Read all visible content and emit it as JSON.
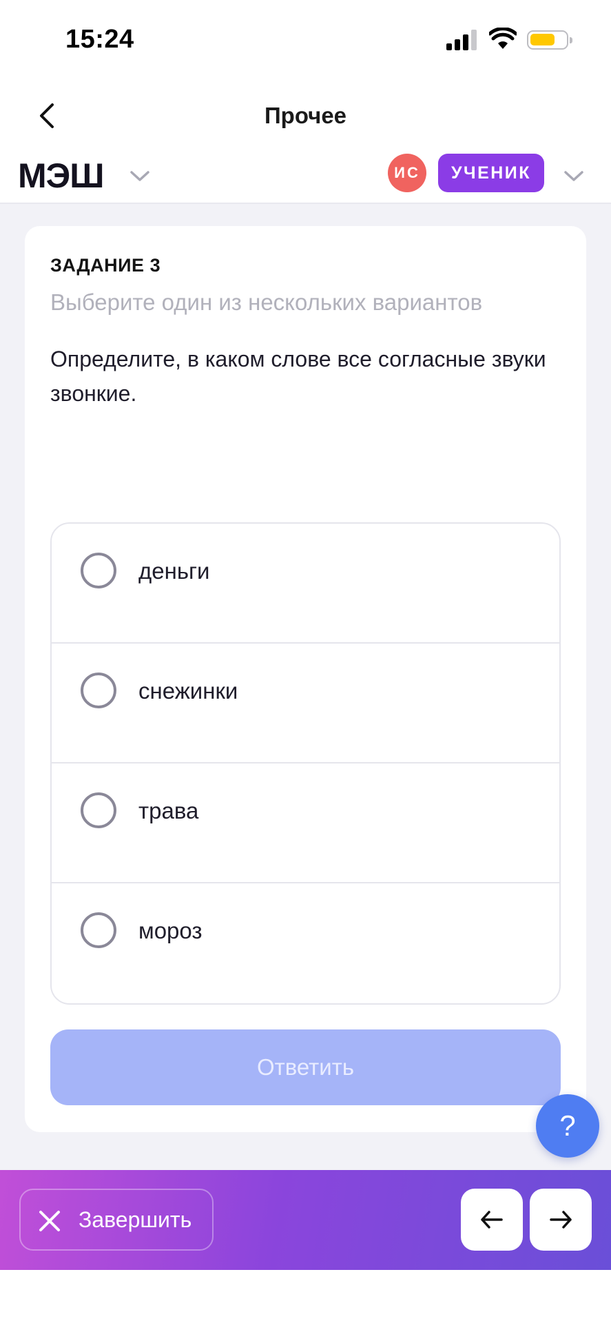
{
  "status_bar": {
    "time": "15:24",
    "battery_level": 0.7,
    "battery_color": "#ffc800"
  },
  "nav": {
    "back_icon": "chevron-left-icon",
    "title": "Прочее"
  },
  "app_header": {
    "logo_text": "МЭШ",
    "avatar_initials": "ИС",
    "avatar_color": "#f0635f",
    "role_label": "УЧЕНИК",
    "role_color": "#8b3ce6"
  },
  "task": {
    "number_label": "ЗАДАНИЕ 3",
    "type_label": "Выберите один из нескольких вариантов",
    "question": "Определите, в каком слове все согласные звуки звонкие.",
    "options": [
      {
        "label": "деньги",
        "selected": false
      },
      {
        "label": "снежинки",
        "selected": false
      },
      {
        "label": "трава",
        "selected": false
      },
      {
        "label": "мороз",
        "selected": false
      }
    ],
    "submit_label": "Ответить",
    "submit_enabled": false
  },
  "help": {
    "label": "?"
  },
  "bottom_bar": {
    "finish_label": "Завершить",
    "prev_icon": "arrow-left-icon",
    "next_icon": "arrow-right-icon"
  }
}
